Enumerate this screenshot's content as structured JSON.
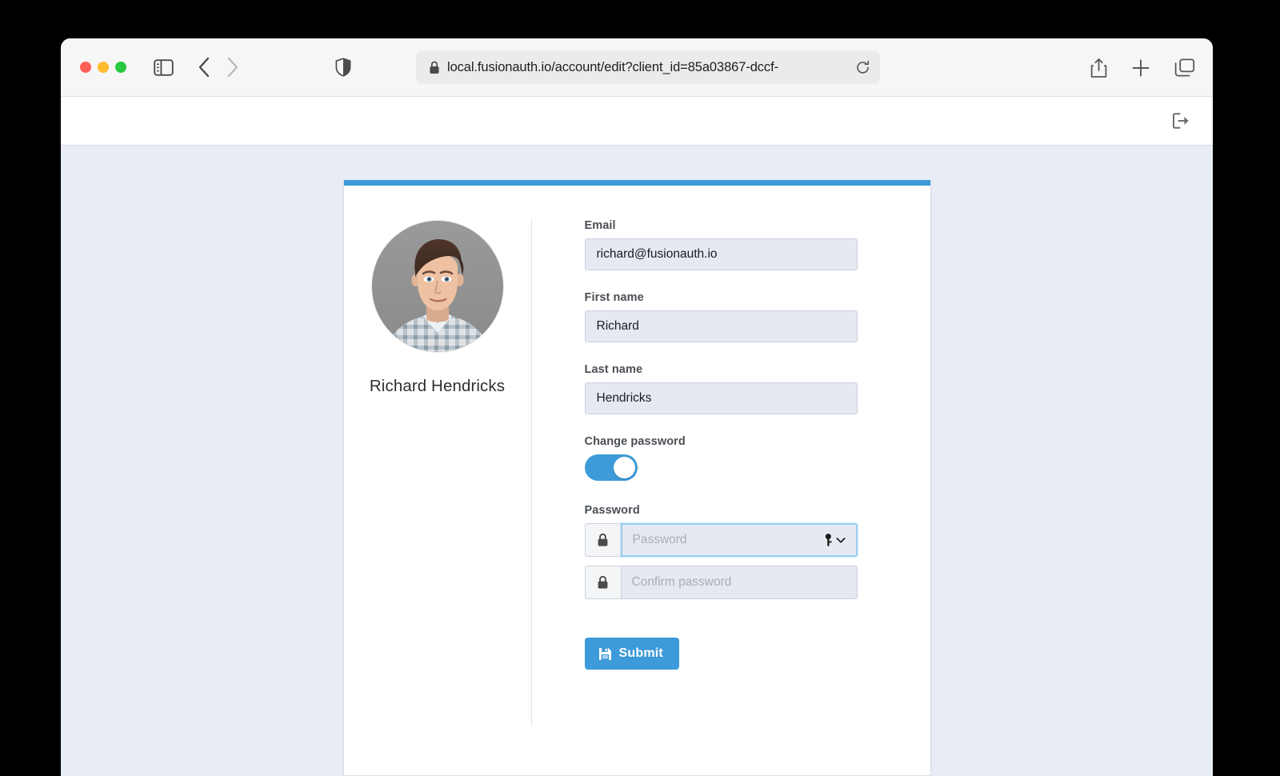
{
  "browser": {
    "traffic_lights": [
      "close",
      "minimize",
      "maximize"
    ],
    "sidebar_icon": "sidebar-icon",
    "back_icon": "chevron-left-icon",
    "forward_icon": "chevron-right-icon",
    "shield_icon": "privacy-shield-icon",
    "address": {
      "lock_icon": "lock-icon",
      "url": "local.fusionauth.io/account/edit?client_id=85a03867-dccf-",
      "reload_icon": "reload-icon"
    },
    "share_icon": "share-icon",
    "new_tab_icon": "plus-icon",
    "tabs_icon": "tab-overview-icon"
  },
  "page_header": {
    "logout_icon": "logout-icon"
  },
  "profile": {
    "avatar_alt": "user-avatar-photo",
    "name": "Richard Hendricks"
  },
  "form": {
    "email": {
      "label": "Email",
      "value": "richard@fusionauth.io"
    },
    "first_name": {
      "label": "First name",
      "value": "Richard"
    },
    "last_name": {
      "label": "Last name",
      "value": "Hendricks"
    },
    "change_password": {
      "label": "Change password",
      "enabled": true
    },
    "password": {
      "label": "Password",
      "placeholder": "Password",
      "value": "",
      "lock_icon": "lock-icon",
      "autofill_icon": "key-chevron-icon",
      "focused": true
    },
    "confirm_password": {
      "placeholder": "Confirm password",
      "value": "",
      "lock_icon": "lock-icon"
    },
    "submit": {
      "label": "Submit",
      "icon": "save-floppy-icon"
    }
  },
  "colors": {
    "accent": "#3d9bd9",
    "page_background": "#e8edf5",
    "card_background": "#ffffff",
    "input_background": "#e4e9f2",
    "label_text": "#4a4f55"
  }
}
